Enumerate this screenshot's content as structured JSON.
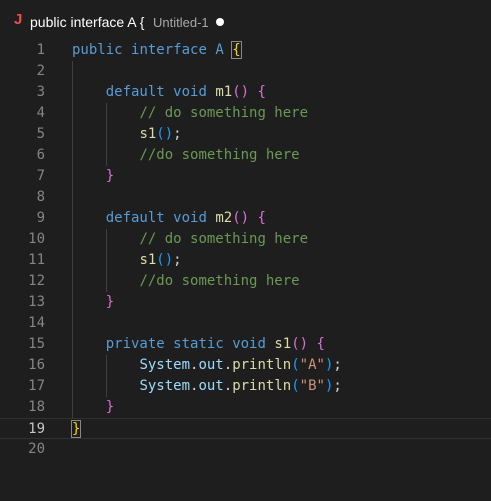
{
  "tab": {
    "icon": "J",
    "title": "public interface A {",
    "description": "Untitled-1",
    "dirty_indicator": "dot-icon"
  },
  "editor": {
    "current_line": 19,
    "lines": [
      {
        "n": "1"
      },
      {
        "n": "2"
      },
      {
        "n": "3"
      },
      {
        "n": "4"
      },
      {
        "n": "5"
      },
      {
        "n": "6"
      },
      {
        "n": "7"
      },
      {
        "n": "8"
      },
      {
        "n": "9"
      },
      {
        "n": "10"
      },
      {
        "n": "11"
      },
      {
        "n": "12"
      },
      {
        "n": "13"
      },
      {
        "n": "14"
      },
      {
        "n": "15"
      },
      {
        "n": "16"
      },
      {
        "n": "17"
      },
      {
        "n": "18"
      },
      {
        "n": "19"
      },
      {
        "n": "20"
      }
    ],
    "code": {
      "l1": {
        "kw": "public",
        "kw2": "interface",
        "name": "A",
        "brace": "{"
      },
      "l3": {
        "kw": "default",
        "kw2": "void",
        "fn": "m1",
        "paren": "()",
        "brace": "{"
      },
      "l4": {
        "comment": "// do something here"
      },
      "l5": {
        "fn": "s1",
        "paren": "()",
        "semi": ";"
      },
      "l6": {
        "comment": "//do something here"
      },
      "l7": {
        "brace": "}"
      },
      "l9": {
        "kw": "default",
        "kw2": "void",
        "fn": "m2",
        "paren": "()",
        "brace": "{"
      },
      "l10": {
        "comment": "// do something here"
      },
      "l11": {
        "fn": "s1",
        "paren": "()",
        "semi": ";"
      },
      "l12": {
        "comment": "//do something here"
      },
      "l13": {
        "brace": "}"
      },
      "l15": {
        "kw": "private",
        "kw2": "static",
        "kw3": "void",
        "fn": "s1",
        "paren": "()",
        "brace": "{"
      },
      "l16": {
        "obj": "System",
        "dot1": ".",
        "field": "out",
        "dot2": ".",
        "fn": "println",
        "open": "(",
        "str": "\"A\"",
        "close": ")",
        "semi": ";"
      },
      "l17": {
        "obj": "System",
        "dot1": ".",
        "field": "out",
        "dot2": ".",
        "fn": "println",
        "open": "(",
        "str": "\"B\"",
        "close": ")",
        "semi": ";"
      },
      "l18": {
        "brace": "}"
      },
      "l19": {
        "brace": "}"
      }
    }
  },
  "colors": {
    "background": "#1e1e1e",
    "keyword": "#569cd6",
    "function": "#dcdcaa",
    "comment": "#6a9955",
    "string": "#ce9178"
  }
}
